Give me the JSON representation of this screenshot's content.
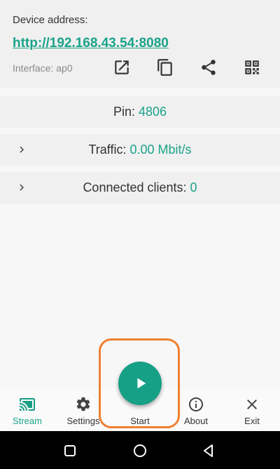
{
  "address_card": {
    "label": "Device address:",
    "url": "http://192.168.43.54:8080",
    "interface": "Interface: ap0",
    "icons": [
      "open-in-new-icon",
      "copy-icon",
      "share-icon",
      "qr-code-icon"
    ]
  },
  "pin": {
    "label": "Pin:",
    "value": "4806"
  },
  "traffic": {
    "label": "Traffic:",
    "value": "0.00 Mbit/s"
  },
  "clients": {
    "label": "Connected clients:",
    "value": "0"
  },
  "nav": {
    "items": [
      {
        "label": "Stream",
        "icon": "cast-icon",
        "active": true
      },
      {
        "label": "Settings",
        "icon": "gear-icon"
      },
      {
        "label": "Start",
        "icon": "play-icon"
      },
      {
        "label": "About",
        "icon": "info-icon"
      },
      {
        "label": "Exit",
        "icon": "close-icon"
      }
    ]
  },
  "colors": {
    "accent": "#16a085",
    "highlight": "#f07f30",
    "card": "#f0f0f0"
  },
  "system_bar": [
    "square-icon",
    "circle-icon",
    "back-icon"
  ]
}
